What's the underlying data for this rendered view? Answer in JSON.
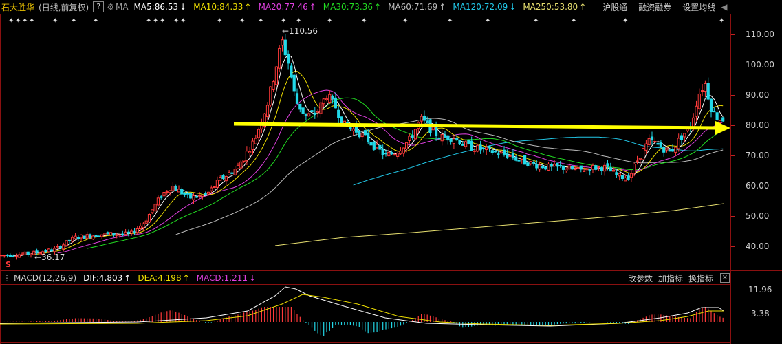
{
  "header": {
    "stock_name": "石大胜华",
    "period": "(日线,前复权)",
    "help": "?",
    "ma_label": "MA",
    "ma_items": [
      {
        "label": "MA5:86.53",
        "arrow": "↓",
        "color": "#ffffff"
      },
      {
        "label": "MA10:84.33",
        "arrow": "↑",
        "color": "#f0e000"
      },
      {
        "label": "MA20:77.46",
        "arrow": "↑",
        "color": "#e040e0"
      },
      {
        "label": "MA30:73.36",
        "arrow": "↑",
        "color": "#22dd22"
      },
      {
        "label": "MA60:71.69",
        "arrow": "↑",
        "color": "#bbbbbb"
      },
      {
        "label": "MA120:72.09",
        "arrow": "↓",
        "color": "#22c8e8"
      },
      {
        "label": "MA250:53.80",
        "arrow": "↑",
        "color": "#e8e070"
      }
    ],
    "buttons": [
      "沪股通",
      "融资融券",
      "设置均线"
    ],
    "collapse": "◀"
  },
  "price_axis": {
    "ticks": [
      {
        "label": "110.00",
        "value": 110
      },
      {
        "label": "100.00",
        "value": 100
      },
      {
        "label": "90.00",
        "value": 90
      },
      {
        "label": "80.00",
        "value": 80
      },
      {
        "label": "70.00",
        "value": 70
      },
      {
        "label": "60.00",
        "value": 60
      },
      {
        "label": "50.00",
        "value": 50
      },
      {
        "label": "40.00",
        "value": 40
      }
    ],
    "high_label": "←110.56",
    "low_label": "←36.17",
    "s_badge": "S"
  },
  "macd": {
    "title": "MACD(12,26,9)",
    "dif": {
      "label": "DIF:4.803",
      "arrow": "↑",
      "color": "#ffffff"
    },
    "dea": {
      "label": "DEA:4.198",
      "arrow": "↑",
      "color": "#f0e000"
    },
    "macd": {
      "label": "MACD:1.211",
      "arrow": "↓",
      "color": "#e040e0"
    },
    "buttons": [
      "改参数",
      "加指标",
      "换指标"
    ],
    "close": "×",
    "ticks": [
      {
        "label": "11.96",
        "value": 11.96
      },
      {
        "label": "3.38",
        "value": 3.38
      }
    ]
  },
  "colors": {
    "up": "#ff3a3a",
    "down": "#22d8e8",
    "trendline": "#ffff00",
    "grid": "#8a1010"
  }
}
